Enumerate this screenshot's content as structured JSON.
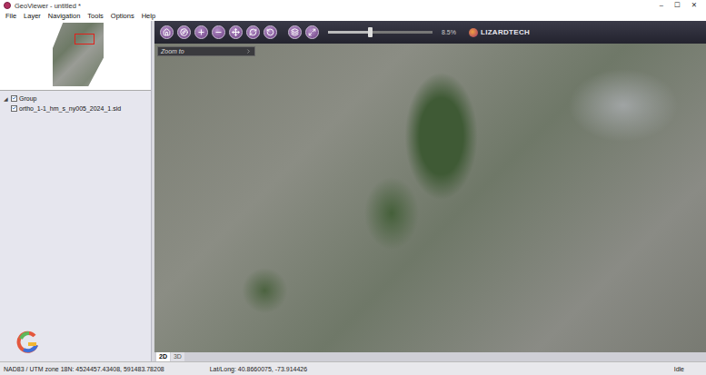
{
  "window": {
    "title": "GeoViewer - untitled *",
    "controls": [
      "–",
      "☐",
      "✕"
    ]
  },
  "menu": [
    "File",
    "Layer",
    "Navigation",
    "Tools",
    "Options",
    "Help"
  ],
  "layer_tree": [
    {
      "label": "Group",
      "checked": true,
      "expanded": true,
      "toggle": "◢",
      "children": [
        {
          "label": "ortho_1-1_hm_s_ny005_2024_1.sid",
          "checked": true
        }
      ]
    }
  ],
  "zoom_slider": {
    "level": 0.4,
    "reading": "8.5%"
  },
  "brand": "LIZARDTECH",
  "zoom_field": {
    "placeholder": "Zoom to"
  },
  "view_tabs": [
    {
      "label": "2D",
      "selected": true
    },
    {
      "label": "3D",
      "selected": false
    }
  ],
  "status_bar": {
    "projection": "NAD83 / UTM zone 18N: 4524457.43408, 591483.78208",
    "latlong": "Lat/Long: 40.8660075, -73.914426",
    "state": "Idle"
  }
}
